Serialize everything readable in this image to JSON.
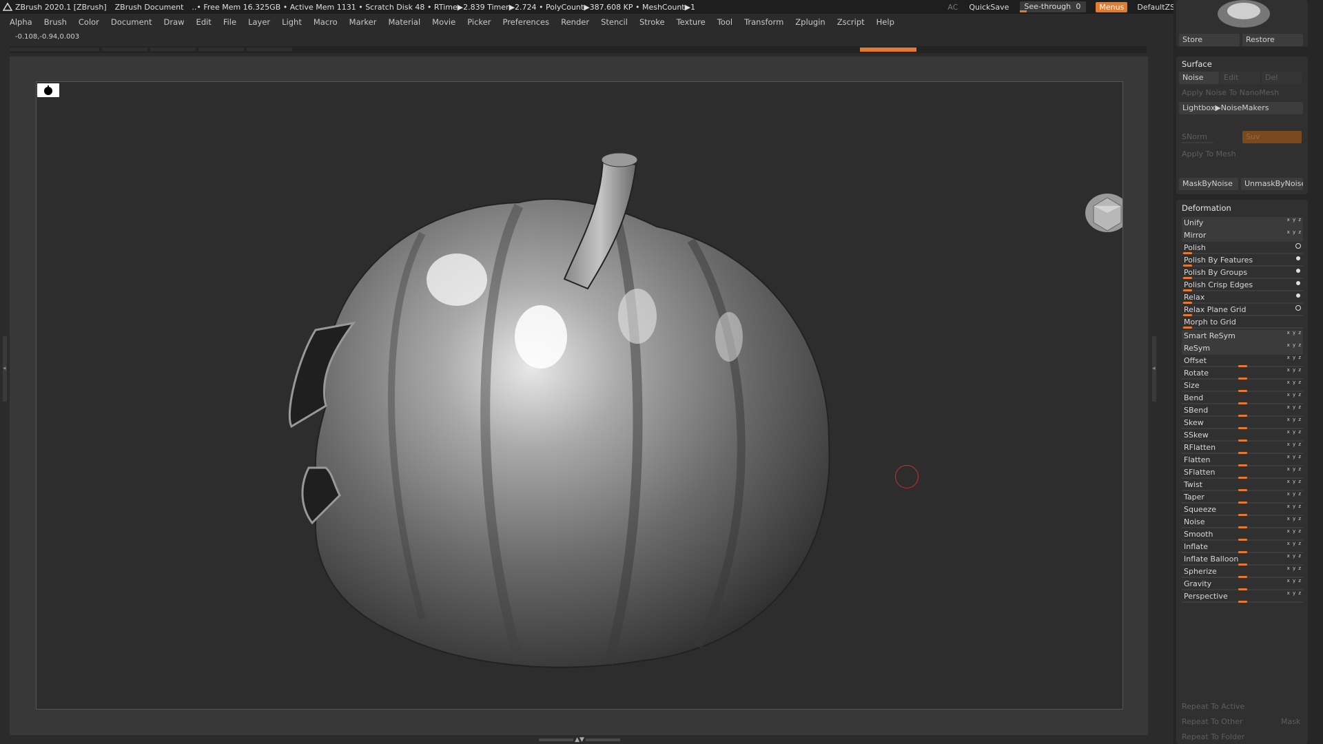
{
  "titlebar": {
    "app": "ZBrush 2020.1 [ZBrush]",
    "document": "ZBrush Document",
    "stats": "..• Free Mem 16.325GB • Active Mem 1131 • Scratch Disk 48 •  RTime▶2.839 Timer▶2.724 • PolyCount▶387.608 KP  • MeshCount▶1",
    "ac": "AC",
    "quicksave": "QuickSave",
    "see_through_label": "See-through",
    "see_through_value": "0",
    "see_through_level": 0,
    "menus": "Menus",
    "script": "DefaultZScript"
  },
  "menubar": [
    "Alpha",
    "Brush",
    "Color",
    "Document",
    "Draw",
    "Edit",
    "File",
    "Layer",
    "Light",
    "Macro",
    "Marker",
    "Material",
    "Movie",
    "Picker",
    "Preferences",
    "Render",
    "Stencil",
    "Stroke",
    "Texture",
    "Tool",
    "Transform",
    "Zplugin",
    "Zscript",
    "Help"
  ],
  "coords": "-0.108,-0.94,0.003",
  "panel": {
    "store": "Store",
    "restore": "Restore",
    "surface": {
      "title": "Surface",
      "noise": "Noise",
      "edit": "Edit",
      "del": "Del",
      "apply_noise_nanomesh": "Apply Noise To NanoMesh",
      "lightbox_noisemakers": "Lightbox▶NoiseMakers",
      "snorm": "SNorm",
      "suv": "Suv",
      "apply_to_mesh": "Apply To Mesh",
      "mask_by_noise": "MaskByNoise",
      "unmask_by_noise": "UnmaskByNoise"
    },
    "deformation": {
      "title": "Deformation",
      "items": [
        {
          "label": "Unify",
          "kind": "button"
        },
        {
          "label": "Mirror",
          "kind": "button"
        },
        {
          "label": "Polish",
          "kind": "ring"
        },
        {
          "label": "Polish By Features",
          "kind": "dot"
        },
        {
          "label": "Polish By Groups",
          "kind": "dot"
        },
        {
          "label": "Polish Crisp Edges",
          "kind": "dot"
        },
        {
          "label": "Relax",
          "kind": "dot"
        },
        {
          "label": "Relax Plane Grid",
          "kind": "ring"
        },
        {
          "label": "Morph to Grid",
          "kind": "none"
        },
        {
          "label": "Smart ReSym",
          "kind": "button"
        },
        {
          "label": "ReSym",
          "kind": "button"
        },
        {
          "label": "Offset",
          "kind": "slider"
        },
        {
          "label": "Rotate",
          "kind": "slider"
        },
        {
          "label": "Size",
          "kind": "slider"
        },
        {
          "label": "Bend",
          "kind": "slider"
        },
        {
          "label": "SBend",
          "kind": "slider"
        },
        {
          "label": "Skew",
          "kind": "slider"
        },
        {
          "label": "SSkew",
          "kind": "slider"
        },
        {
          "label": "RFlatten",
          "kind": "slider"
        },
        {
          "label": "Flatten",
          "kind": "slider"
        },
        {
          "label": "SFlatten",
          "kind": "slider"
        },
        {
          "label": "Twist",
          "kind": "slider"
        },
        {
          "label": "Taper",
          "kind": "slider"
        },
        {
          "label": "Squeeze",
          "kind": "slider"
        },
        {
          "label": "Noise",
          "kind": "slider"
        },
        {
          "label": "Smooth",
          "kind": "slider"
        },
        {
          "label": "Inflate",
          "kind": "slider"
        },
        {
          "label": "Inflate Balloon",
          "kind": "slider"
        },
        {
          "label": "Spherize",
          "kind": "slider"
        },
        {
          "label": "Gravity",
          "kind": "slider"
        },
        {
          "label": "Perspective",
          "kind": "slider"
        }
      ],
      "repeat_to_active": "Repeat To Active",
      "repeat_to_other": "Repeat To Other",
      "mask": "Mask",
      "repeat_to_folder": "Repeat To Folder"
    }
  },
  "colors": {
    "accent": "#e57a2c",
    "gizmo_x": "#e02020",
    "gizmo_y": "#20d020",
    "gizmo_z": "#1e3cff"
  }
}
